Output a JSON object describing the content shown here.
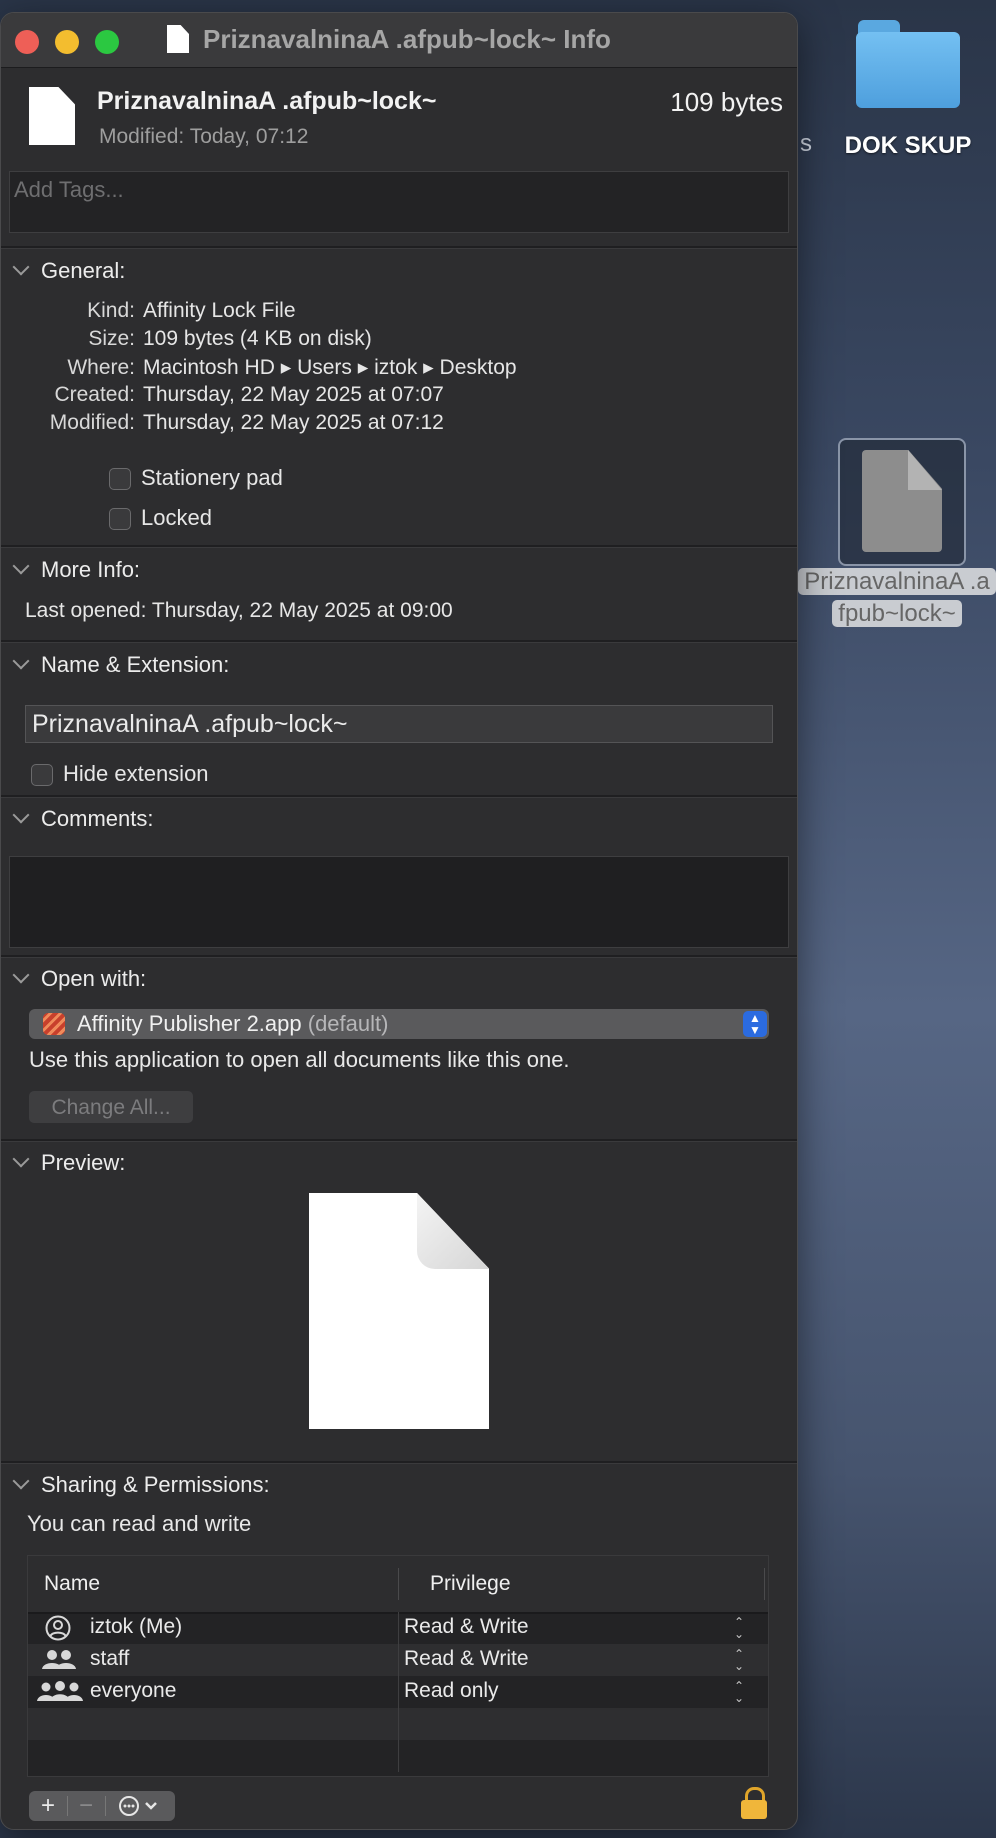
{
  "desktop": {
    "folder_label": "DOK SKUP",
    "stray_text": "s",
    "file_label_line1": "PriznavalninaA .a",
    "file_label_line2": "fpub~lock~"
  },
  "window": {
    "title": "PriznavalninaA .afpub~lock~ Info"
  },
  "header": {
    "file_name": "PriznavalninaA .afpub~lock~",
    "file_size": "109 bytes",
    "modified_label": "Modified:",
    "modified_value": "Today, 07:12",
    "tags_placeholder": "Add Tags..."
  },
  "general": {
    "heading": "General:",
    "rows": [
      {
        "key": "Kind:",
        "value": "Affinity Lock File"
      },
      {
        "key": "Size:",
        "value": "109 bytes (4 KB on disk)"
      },
      {
        "key": "Where:",
        "value": "Macintosh HD ▸ Users ▸ iztok ▸ Desktop"
      },
      {
        "key": "Created:",
        "value": "Thursday, 22 May 2025 at 07:07"
      },
      {
        "key": "Modified:",
        "value": "Thursday, 22 May 2025 at 07:12"
      }
    ],
    "stationery_label": "Stationery pad",
    "locked_label": "Locked"
  },
  "more_info": {
    "heading": "More Info:",
    "last_opened_label": "Last opened:",
    "last_opened_value": "Thursday, 22 May 2025 at 09:00"
  },
  "name_extension": {
    "heading": "Name & Extension:",
    "name_value": "PriznavalninaA .afpub~lock~",
    "hide_extension_label": "Hide extension"
  },
  "comments": {
    "heading": "Comments:"
  },
  "open_with": {
    "heading": "Open with:",
    "app_name": "Affinity Publisher 2.app",
    "app_default": "(default)",
    "description": "Use this application to open all documents like this one.",
    "change_all_label": "Change All..."
  },
  "preview": {
    "heading": "Preview:"
  },
  "sharing": {
    "heading": "Sharing & Permissions:",
    "status": "You can read and write",
    "col_name": "Name",
    "col_privilege": "Privilege",
    "rows": [
      {
        "name": "iztok (Me)",
        "privilege": "Read & Write",
        "icon": "single-user-icon"
      },
      {
        "name": "staff",
        "privilege": "Read & Write",
        "icon": "group-icon"
      },
      {
        "name": "everyone",
        "privilege": "Read only",
        "icon": "everyone-icon"
      }
    ],
    "add_symbol": "+",
    "remove_symbol": "−"
  },
  "colors": {
    "window_bg": "#2d2d2f",
    "accent_blue": "#2b6be0",
    "lock_gold": "#f0b63a",
    "traffic_red": "#ee5f57",
    "traffic_yellow": "#f3bd2f",
    "traffic_green": "#2bc841"
  }
}
